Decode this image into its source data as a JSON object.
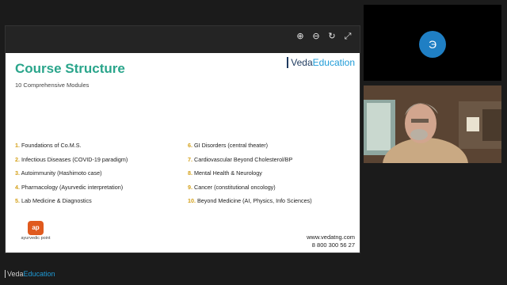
{
  "toolbar": {
    "icons": [
      "zoom-in-icon",
      "zoom-out-icon",
      "refresh-icon",
      "expand-icon"
    ]
  },
  "slide": {
    "title": "Course Structure",
    "subtitle": "10 Comprehensive Modules",
    "brand_prefix": "Veda",
    "brand_suffix": "Education",
    "modules": [
      {
        "num": "1.",
        "label": "Foundations of Co.M.S."
      },
      {
        "num": "6.",
        "label": "GI Disorders (central theater)"
      },
      {
        "num": "2.",
        "label": "Infectious Diseases (COVID-19 paradigm)"
      },
      {
        "num": "7.",
        "label": "Cardiovascular Beyond Cholesterol/BP"
      },
      {
        "num": "3.",
        "label": "Autoimmunity (Hashimoto case)"
      },
      {
        "num": "8.",
        "label": "Mental Health & Neurology"
      },
      {
        "num": "4.",
        "label": "Pharmacology (Ayurvedic interpretation)"
      },
      {
        "num": "9.",
        "label": "Cancer (constitutional oncology)"
      },
      {
        "num": "5.",
        "label": "Lab Medicine & Diagnostics"
      },
      {
        "num": "10.",
        "label": "Beyond Medicine (AI, Physics, Info Sciences)"
      }
    ],
    "logo_badge": "ap",
    "logo_text": "ayurvedic point",
    "website": "www.vedatng.com",
    "phone": "8 800 300 56 27",
    "accent_color": "#2aa58b",
    "number_color": "#d4a018"
  },
  "participants": {
    "avatar_initial": "Э",
    "avatar_color": "#1f7fc4"
  },
  "footer": {
    "brand_prefix": "Veda",
    "brand_suffix": "Education"
  }
}
